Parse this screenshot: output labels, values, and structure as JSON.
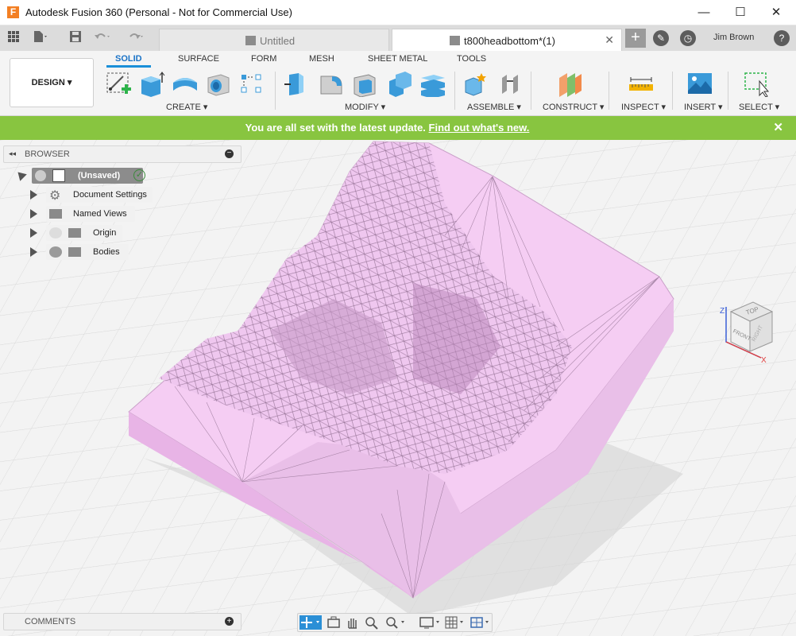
{
  "window": {
    "app_icon": "F",
    "title": "Autodesk Fusion 360 (Personal - Not for Commercial Use)",
    "minimize": "—",
    "maximize": "☐",
    "close": "✕"
  },
  "tabs": [
    {
      "label": "Untitled",
      "active": false
    },
    {
      "label": "t800headbottom*(1)",
      "active": true
    }
  ],
  "header": {
    "user": "Jim Brown",
    "help": "?",
    "quick_icons": [
      "grid-icon",
      "file-icon",
      "save-icon",
      "undo-icon",
      "redo-icon"
    ]
  },
  "toolbar": {
    "design_button": "DESIGN ▾",
    "workspace_tabs": [
      "SOLID",
      "SURFACE",
      "FORM",
      "MESH",
      "SHEET METAL",
      "TOOLS"
    ],
    "active_workspace": "SOLID",
    "groups": [
      "CREATE ▾",
      "MODIFY ▾",
      "ASSEMBLE ▾",
      "CONSTRUCT ▾",
      "INSPECT ▾",
      "INSERT ▾",
      "SELECT ▾"
    ]
  },
  "banner": {
    "message": "You are all set with the latest update.",
    "link": "Find out what's new.",
    "color": "#88c540"
  },
  "browser": {
    "title": "BROWSER",
    "root": "(Unsaved)",
    "items": [
      {
        "label": "Document Settings",
        "icon": "gear-icon"
      },
      {
        "label": "Named Views",
        "icon": "folder-icon"
      },
      {
        "label": "Origin",
        "icon": "folder-icon"
      },
      {
        "label": "Bodies",
        "icon": "folder-icon"
      }
    ]
  },
  "comments": {
    "title": "COMMENTS"
  },
  "viewcube": {
    "top": "TOP",
    "front": "FRONT",
    "right": "RIGHT",
    "axis_z": "Z",
    "axis_x": "X"
  },
  "colors": {
    "accent": "#1a8fd8",
    "mesh_fill": "#f0c8f0",
    "banner": "#88c540"
  }
}
